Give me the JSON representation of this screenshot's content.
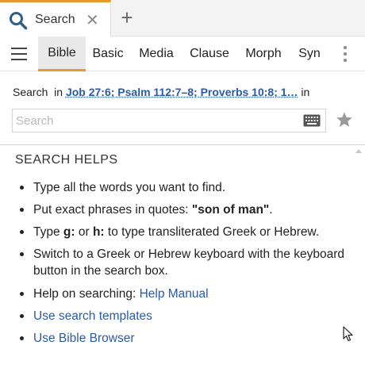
{
  "tab": {
    "label": "Search",
    "close_glyph": "✕",
    "icon": "search-icon"
  },
  "new_tab_glyph": "+",
  "toolbar": {
    "menu_icon": "hamburger-menu-icon",
    "modes": [
      "Bible",
      "Basic",
      "Media",
      "Clause",
      "Morph",
      "Syn"
    ],
    "active_mode": "Bible",
    "more_icon": "vertical-dots-icon"
  },
  "search": {
    "label": "Search",
    "in_label": "in",
    "range": "Job 27:6; Psalm 112:7–8; Proverbs 10:8; 1…",
    "trailing_in": "in",
    "placeholder": "Search",
    "value": "",
    "keyboard_icon": "keyboard-icon",
    "favorite_icon": "star-icon"
  },
  "helps": {
    "title": "SEARCH HELPS",
    "items": {
      "i0": "Type all the words you want to find.",
      "i1_pre": "Put exact phrases in quotes: ",
      "i1_bold": "\"son of man\"",
      "i1_post": ".",
      "i2_pre": "Type ",
      "i2_g": "g:",
      "i2_mid": " or ",
      "i2_h": "h:",
      "i2_post": " to type transliterated Greek or Hebrew.",
      "i3": "Switch to a Greek or Hebrew keyboard with the keyboard button in the search box.",
      "i4_pre": "Help on searching: ",
      "i4_link": "Help Manual",
      "i5_link": "Use search templates",
      "i6_link": "Use Bible Browser"
    }
  },
  "colors": {
    "accent": "#e89a2c",
    "link": "#2a5aa8"
  }
}
